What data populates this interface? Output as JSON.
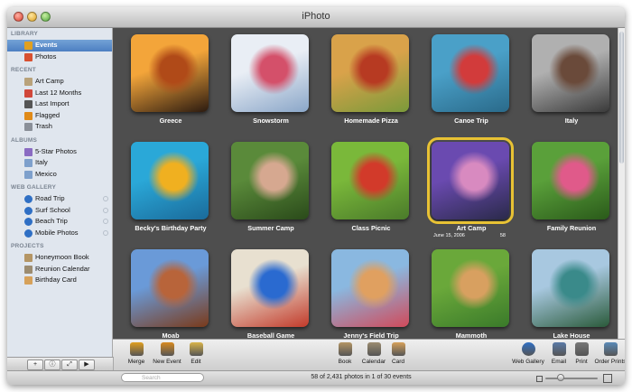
{
  "window": {
    "title": "iPhoto"
  },
  "sidebar": {
    "sections": [
      {
        "title": "LIBRARY",
        "items": [
          {
            "label": "Events",
            "icon": "events-icon",
            "color": "#e0a020",
            "selected": true
          },
          {
            "label": "Photos",
            "icon": "photos-icon",
            "color": "#d85030"
          }
        ]
      },
      {
        "title": "RECENT",
        "items": [
          {
            "label": "Art Camp",
            "icon": "event-icon",
            "color": "#b9a27a"
          },
          {
            "label": "Last 12 Months",
            "icon": "calendar-icon",
            "color": "#d0473a"
          },
          {
            "label": "Last Import",
            "icon": "import-icon",
            "color": "#555555"
          },
          {
            "label": "Flagged",
            "icon": "flag-icon",
            "color": "#e08a18"
          },
          {
            "label": "Trash",
            "icon": "trash-icon",
            "color": "#8a8f98"
          }
        ]
      },
      {
        "title": "ALBUMS",
        "items": [
          {
            "label": "5-Star Photos",
            "icon": "smart-album-icon",
            "color": "#8a6bc2"
          },
          {
            "label": "Italy",
            "icon": "album-icon",
            "color": "#7ea0cc"
          },
          {
            "label": "Mexico",
            "icon": "album-icon",
            "color": "#7ea0cc"
          }
        ]
      },
      {
        "title": "WEB GALLERY",
        "items": [
          {
            "label": "Road Trip",
            "icon": "globe-icon",
            "color": "#2f6fc4",
            "web": true
          },
          {
            "label": "Surf School",
            "icon": "globe-icon",
            "color": "#2f6fc4",
            "web": true
          },
          {
            "label": "Beach Trip",
            "icon": "globe-icon",
            "color": "#2f6fc4",
            "web": true
          },
          {
            "label": "Mobile Photos",
            "icon": "globe-icon",
            "color": "#2f6fc4",
            "web": true
          }
        ]
      },
      {
        "title": "PROJECTS",
        "items": [
          {
            "label": "Honeymoon Book",
            "icon": "book-icon",
            "color": "#b49564"
          },
          {
            "label": "Reunion Calendar",
            "icon": "calendar-project-icon",
            "color": "#9c8c70"
          },
          {
            "label": "Birthday Card",
            "icon": "card-icon",
            "color": "#d6a15a"
          }
        ]
      }
    ],
    "bottom_buttons": [
      {
        "label": "+",
        "name": "add-button"
      },
      {
        "label": "ⓘ",
        "name": "info-button"
      },
      {
        "label": "⤢",
        "name": "fullscreen-button"
      },
      {
        "label": "▶",
        "name": "slideshow-button"
      }
    ]
  },
  "events": [
    {
      "title": "Greece",
      "colors": [
        "#f3a53a",
        "#b04a18",
        "#2b1a10"
      ]
    },
    {
      "title": "Snowstorm",
      "colors": [
        "#e9eef5",
        "#d4506a",
        "#8aa6c8"
      ]
    },
    {
      "title": "Homemade Pizza",
      "colors": [
        "#d9a24a",
        "#b73a22",
        "#7a9a3a"
      ]
    },
    {
      "title": "Canoe Trip",
      "colors": [
        "#4aa0c8",
        "#d23b3b",
        "#2a6a8a"
      ]
    },
    {
      "title": "Italy",
      "colors": [
        "#b0b0b0",
        "#6a4a3a",
        "#3a3a3a"
      ]
    },
    {
      "title": "Becky's Birthday Party",
      "colors": [
        "#2aa8d8",
        "#f0b020",
        "#1a6a9a"
      ]
    },
    {
      "title": "Summer Camp",
      "colors": [
        "#5a8a3a",
        "#d6a890",
        "#2a4a1a"
      ]
    },
    {
      "title": "Class Picnic",
      "colors": [
        "#7ab83a",
        "#d23a2a",
        "#4a7a2a"
      ]
    },
    {
      "title": "Art Camp",
      "colors": [
        "#6a4ab0",
        "#d88ac0",
        "#2a2a4a"
      ],
      "highlighted": true,
      "date": "June 15, 2006",
      "count": "58"
    },
    {
      "title": "Family Reunion",
      "colors": [
        "#5aa03a",
        "#e05a8a",
        "#2a5a1a"
      ]
    },
    {
      "title": "Moab",
      "colors": [
        "#6a9ad8",
        "#b8643a",
        "#7a3a1a"
      ]
    },
    {
      "title": "Baseball Game",
      "colors": [
        "#e8e0d0",
        "#2a6ad0",
        "#c23a2a"
      ]
    },
    {
      "title": "Jenny's Field Trip",
      "colors": [
        "#8ab8e0",
        "#e0a060",
        "#d04a5a"
      ]
    },
    {
      "title": "Mammoth",
      "colors": [
        "#6aa83a",
        "#d8a060",
        "#3a7a2a"
      ]
    },
    {
      "title": "Lake House",
      "colors": [
        "#a8c8e0",
        "#3a8a8a",
        "#2a5a3a"
      ]
    }
  ],
  "toolbar": {
    "left": [
      {
        "label": "Merge",
        "icon": "merge-icon",
        "color": "#e0a020"
      },
      {
        "label": "New Event",
        "icon": "new-event-icon",
        "color": "#d88a20"
      },
      {
        "label": "Edit",
        "icon": "edit-icon",
        "color": "#d9b44a"
      }
    ],
    "center": [
      {
        "label": "Book",
        "icon": "book-icon",
        "color": "#b49564"
      },
      {
        "label": "Calendar",
        "icon": "calendar-icon",
        "color": "#9c8c70"
      },
      {
        "label": "Card",
        "icon": "card-icon",
        "color": "#d6a15a"
      }
    ],
    "right": [
      {
        "label": "Web Gallery",
        "icon": "web-gallery-icon",
        "color": "#2f6fc4"
      },
      {
        "label": "Email",
        "icon": "email-icon",
        "color": "#5a7aa8"
      },
      {
        "label": "Print",
        "icon": "print-icon",
        "color": "#777777"
      },
      {
        "label": "Order Prints",
        "icon": "order-prints-icon",
        "color": "#5a8ab8"
      }
    ]
  },
  "status": {
    "search_placeholder": "Search",
    "summary": "58 of 2,431 photos in 1 of 30 events"
  }
}
